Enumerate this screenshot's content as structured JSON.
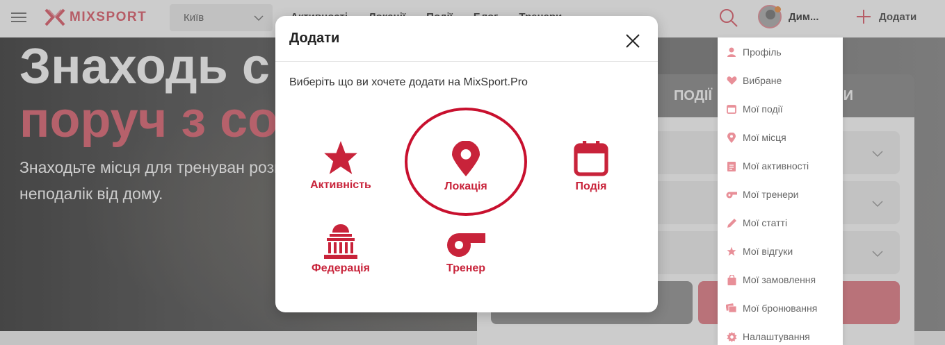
{
  "header": {
    "logo_text": "MIXSPORT",
    "city": "Київ",
    "nav": [
      "Активності",
      "Локації",
      "Події",
      "Блог",
      "Тренери"
    ],
    "user_name": "Дим...",
    "add_label": "Додати"
  },
  "hero": {
    "title_line1": "Знаходь с",
    "title_line2": "поруч з со",
    "subtitle": "Знаходьте місця для тренуван розваг неподалік від дому."
  },
  "panel": {
    "tab_events": "ПОДІЇ",
    "tab_trainers": "ЕРИ"
  },
  "modal": {
    "title": "Додати",
    "description": "Виберіть що ви хочете додати на MixSport.Pro",
    "options": [
      {
        "label": "Активність",
        "icon": "star-icon"
      },
      {
        "label": "Локація",
        "icon": "map-pin-icon"
      },
      {
        "label": "Подія",
        "icon": "calendar-icon"
      },
      {
        "label": "Федерація",
        "icon": "building-icon"
      },
      {
        "label": "Тренер",
        "icon": "whistle-icon"
      }
    ],
    "highlighted_option": "Локація"
  },
  "user_menu": {
    "items": [
      {
        "label": "Профіль",
        "icon": "user-icon"
      },
      {
        "label": "Вибране",
        "icon": "heart-icon"
      },
      {
        "label": "Мої події",
        "icon": "calendar-icon"
      },
      {
        "label": "Мої місця",
        "icon": "map-pin-icon"
      },
      {
        "label": "Мої активності",
        "icon": "list-icon"
      },
      {
        "label": "Мої тренери",
        "icon": "whistle-icon"
      },
      {
        "label": "Мої статті",
        "icon": "pencil-icon"
      },
      {
        "label": "Мої відгуки",
        "icon": "star-icon"
      },
      {
        "label": "Мої замовлення",
        "icon": "bag-icon"
      },
      {
        "label": "Мої бронювання",
        "icon": "tickets-icon"
      },
      {
        "label": "Налаштування",
        "icon": "gear-icon"
      }
    ]
  },
  "colors": {
    "brand": "#e47480",
    "accent_red": "#c8233a",
    "highlight_ring": "#c8102e",
    "menu_icon": "#e88f98"
  }
}
